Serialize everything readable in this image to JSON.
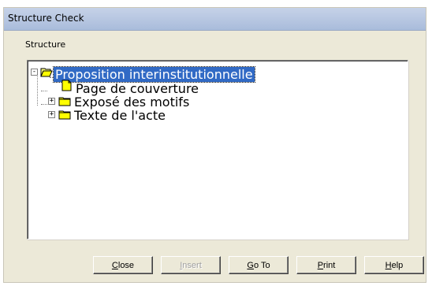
{
  "window": {
    "title": "Structure Check"
  },
  "group": {
    "label": "Structure"
  },
  "tree": {
    "nodes": [
      {
        "label": "Proposition interinstitutionnelle",
        "icon": "open-folder-icon",
        "expander": "-",
        "selected": true
      },
      {
        "label": "Page de couverture",
        "icon": "document-icon",
        "expander": "",
        "selected": false
      },
      {
        "label": "Exposé des motifs",
        "icon": "folder-icon",
        "expander": "+",
        "selected": false
      },
      {
        "label": "Texte de l'acte",
        "icon": "folder-icon",
        "expander": "+",
        "selected": false
      }
    ]
  },
  "buttons": {
    "close": {
      "accel": "C",
      "rest": "lose",
      "enabled": true
    },
    "insert": {
      "accel": "I",
      "rest": "nsert",
      "enabled": false
    },
    "goto": {
      "accel": "G",
      "rest": "o To",
      "enabled": true
    },
    "print": {
      "accel": "P",
      "rest": "rint",
      "enabled": true
    },
    "help": {
      "accel": "H",
      "rest": "elp",
      "enabled": true
    }
  },
  "colors": {
    "selection": "#316ac5",
    "folder_fill": "#ffff00",
    "dialog_bg": "#ece9d8"
  }
}
